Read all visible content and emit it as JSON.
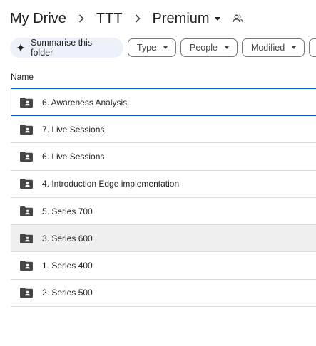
{
  "breadcrumb": {
    "items": [
      "My Drive",
      "TTT"
    ],
    "separator": ">",
    "current": "Premium"
  },
  "toolbar": {
    "summarise_label": "Summarise this folder",
    "filters": [
      "Type",
      "People",
      "Modified"
    ]
  },
  "list": {
    "column_name": "Name",
    "rows": [
      {
        "name": "6. Awareness Analysis",
        "icon": "shared-folder-icon"
      },
      {
        "name": "7. Live Sessions",
        "icon": "shared-folder-icon"
      },
      {
        "name": "6. Live Sessions",
        "icon": "shared-folder-icon"
      },
      {
        "name": "4. Introduction Edge implementation",
        "icon": "shared-folder-icon"
      },
      {
        "name": "5. Series 700",
        "icon": "shared-folder-icon"
      },
      {
        "name": "3. Series 600",
        "icon": "shared-folder-icon"
      },
      {
        "name": "1. Series 400",
        "icon": "shared-folder-icon"
      },
      {
        "name": "2. Series 500",
        "icon": "shared-folder-icon"
      }
    ]
  },
  "colors": {
    "selected_border": "#0b57d0",
    "hover_row": "#efefef",
    "summarise_bg": "#edf2fa"
  }
}
